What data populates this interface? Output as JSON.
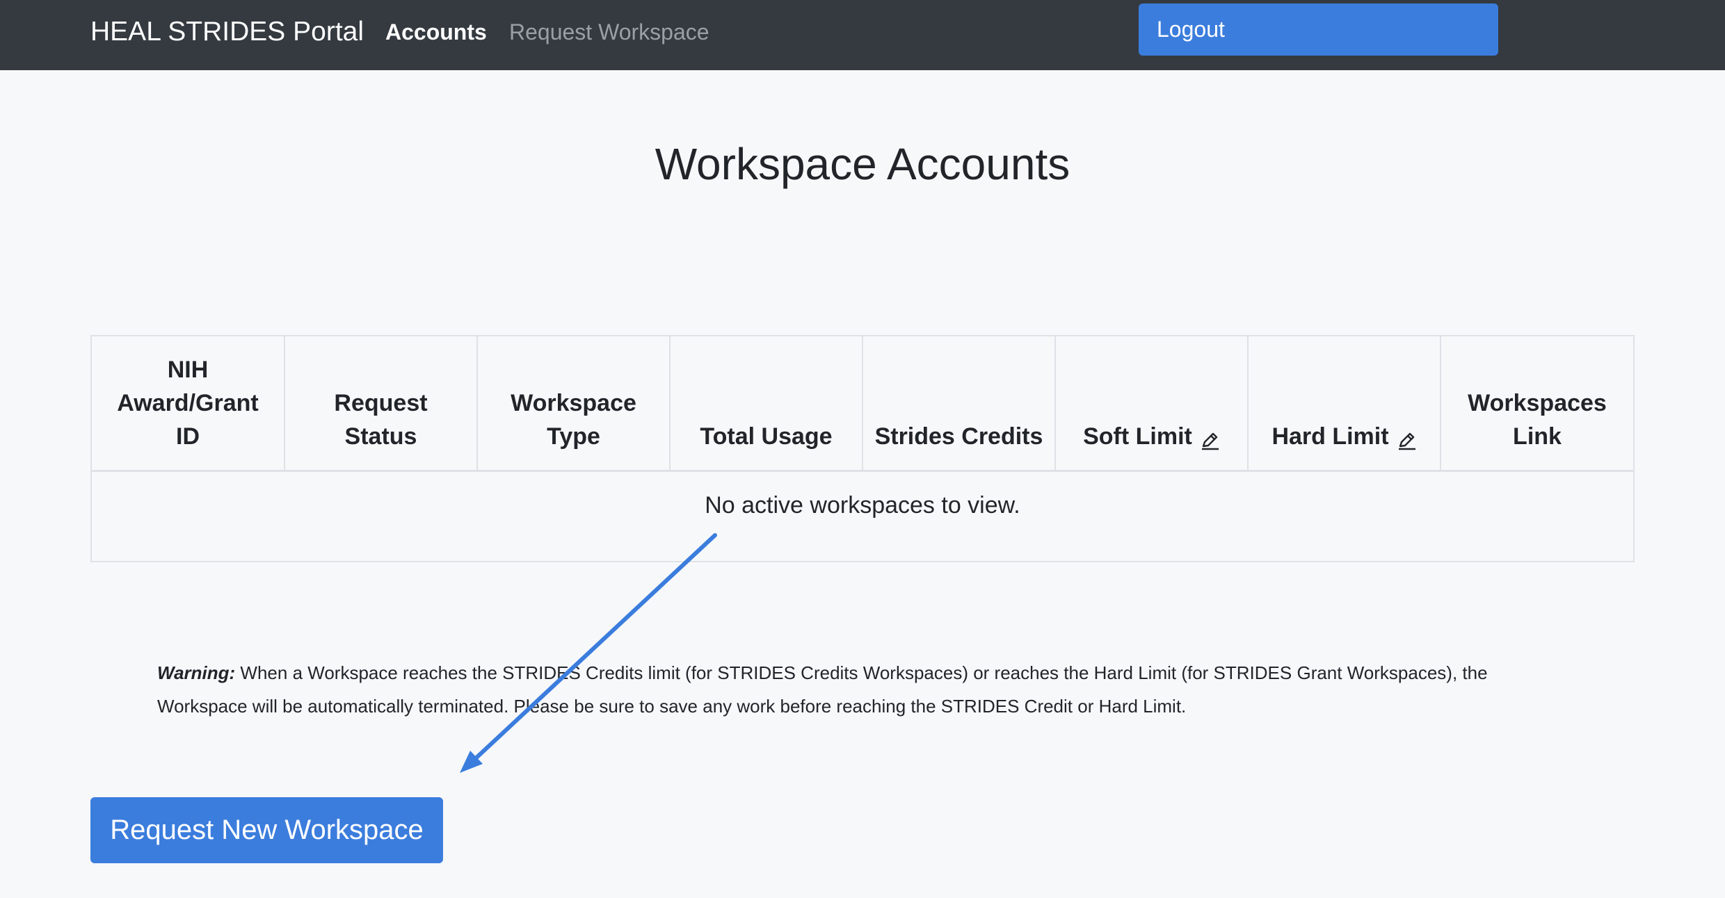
{
  "navbar": {
    "brand": "HEAL STRIDES Portal",
    "links": [
      {
        "label": "Accounts",
        "active": true
      },
      {
        "label": "Request Workspace",
        "active": false
      }
    ],
    "logout_label": "Logout"
  },
  "main": {
    "title": "Workspace Accounts",
    "table": {
      "headers": [
        "NIH Award/Grant ID",
        "Request Status",
        "Workspace Type",
        "Total Usage",
        "Strides Credits",
        "Soft Limit",
        "Hard Limit",
        "Workspaces Link"
      ],
      "empty_message": "No active workspaces to view."
    },
    "warning": {
      "label": "Warning:",
      "text": "When a Workspace reaches the STRIDES Credits limit (for STRIDES Credits Workspaces) or reaches the Hard Limit (for STRIDES Grant Workspaces), the Workspace will be automatically terminated. Please be sure to save any work before reaching the STRIDES Credit or Hard Limit."
    },
    "request_button_label": "Request New Workspace"
  },
  "colors": {
    "navbar_bg": "#343a40",
    "primary": "#3b7ddd",
    "page_bg": "#f7f8fa",
    "annotation_arrow": "#3b7ddd"
  },
  "icons": {
    "soft_limit_edit": "pencil-icon",
    "hard_limit_edit": "pencil-icon"
  }
}
